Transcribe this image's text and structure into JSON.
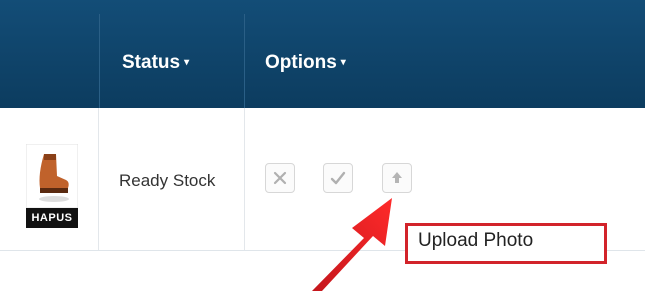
{
  "header": {
    "columns": [
      {
        "label": "Status",
        "caret": "▾"
      },
      {
        "label": "Options",
        "caret": "▾"
      }
    ]
  },
  "row": {
    "product_image": {
      "icon": "boot-icon",
      "brand": "HAPUS"
    },
    "status": "Ready Stock",
    "actions": [
      {
        "icon": "close-icon"
      },
      {
        "icon": "check-icon"
      },
      {
        "icon": "upload-icon"
      }
    ]
  },
  "annotation": {
    "label": "Upload Photo",
    "color": "#d2232a"
  },
  "colors": {
    "header_bg": "#0c3c5f",
    "accent": "#d2232a"
  }
}
